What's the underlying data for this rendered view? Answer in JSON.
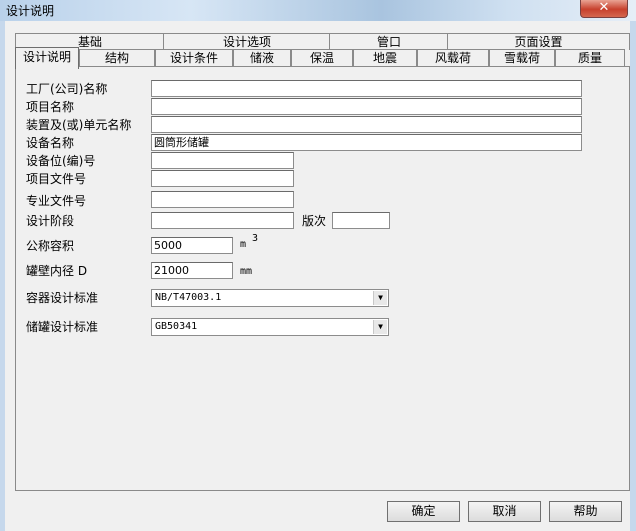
{
  "window": {
    "title": "设计说明",
    "close_glyph": "✕"
  },
  "tabs_row1": [
    "基础",
    "设计选项",
    "管口",
    "页面设置"
  ],
  "tabs_row2": [
    "设计说明",
    "结构",
    "设计条件",
    "储液",
    "保温",
    "地震",
    "风载荷",
    "雪载荷",
    "质量"
  ],
  "active_tab": "设计说明",
  "form": {
    "factory_name": {
      "label": "工厂(公司)名称",
      "value": ""
    },
    "project_name": {
      "label": "项目名称",
      "value": ""
    },
    "unit_name": {
      "label": "装置及(或)单元名称",
      "value": ""
    },
    "equipment_name": {
      "label": "设备名称",
      "value": "圆筒形储罐"
    },
    "equipment_tag": {
      "label": "设备位(编)号",
      "value": ""
    },
    "project_file_no": {
      "label": "项目文件号",
      "value": ""
    },
    "discipline_file_no": {
      "label": "专业文件号",
      "value": ""
    },
    "design_stage": {
      "label": "设计阶段",
      "value": ""
    },
    "revision": {
      "label": "版次",
      "value": ""
    },
    "nominal_volume": {
      "label": "公称容积",
      "value": "5000",
      "unit": "m",
      "unit_sup": "3"
    },
    "inner_diameter": {
      "label": "罐壁内径 D",
      "value": "21000",
      "unit": "mm"
    },
    "vessel_standard": {
      "label": "容器设计标准",
      "value": "NB/T47003.1"
    },
    "tank_standard": {
      "label": "储罐设计标准",
      "value": "GB50341"
    }
  },
  "buttons": {
    "ok": "确定",
    "cancel": "取消",
    "help": "帮助"
  },
  "icons": {
    "close": "close-icon",
    "dropdown": "chevron-down-icon"
  }
}
